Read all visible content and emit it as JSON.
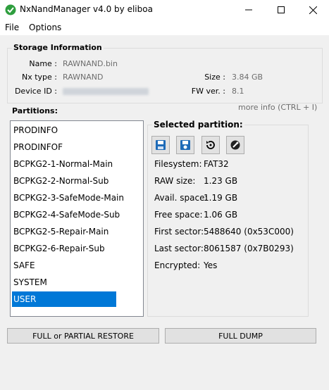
{
  "window": {
    "title": "NxNandManager v4.0 by eliboa",
    "controls": [
      "minimize-icon",
      "maximize-icon",
      "close-icon"
    ],
    "icon": "app-leaf-icon"
  },
  "menu": {
    "file": "File",
    "options": "Options"
  },
  "storage": {
    "title": "Storage Information",
    "name_label": "Name :",
    "name_value": "RAWNAND.bin",
    "nxtype_label": "Nx type :",
    "nxtype_value": "RAWNAND",
    "deviceid_label": "Device ID :",
    "size_label": "Size :",
    "size_value": "3.84 GB",
    "fw_label": "FW ver. :",
    "fw_value": "8.1",
    "more_info": "more info (CTRL + I)"
  },
  "partitions": {
    "title": "Partitions:",
    "items": [
      {
        "label": "PRODINFO"
      },
      {
        "label": "PRODINFOF"
      },
      {
        "label": "BCPKG2-1-Normal-Main"
      },
      {
        "label": "BCPKG2-2-Normal-Sub"
      },
      {
        "label": "BCPKG2-3-SafeMode-Main"
      },
      {
        "label": "BCPKG2-4-SafeMode-Sub"
      },
      {
        "label": "BCPKG2-5-Repair-Main"
      },
      {
        "label": "BCPKG2-6-Repair-Sub"
      },
      {
        "label": "SAFE"
      },
      {
        "label": "SYSTEM"
      },
      {
        "label": "USER"
      }
    ],
    "selected": "USER"
  },
  "selected_partition": {
    "title": "Selected partition:",
    "tools": [
      "dump-icon",
      "dump-to-folder-icon",
      "restore-icon",
      "crypto-icon"
    ],
    "filesystem_label": "Filesystem:",
    "filesystem_value": "FAT32",
    "rawsize_label": "RAW size:",
    "rawsize_value": "1.23 GB",
    "avail_label": "Avail. space:",
    "avail_value": "1.19 GB",
    "free_label": "Free space:",
    "free_value": "1.06 GB",
    "first_label": "First sector:",
    "first_value": "5488640 (0x53C000)",
    "last_label": "Last sector:",
    "last_value": "8061587 (0x7B0293)",
    "encrypted_label": "Encrypted:",
    "encrypted_value": "Yes"
  },
  "buttons": {
    "restore": "FULL or PARTIAL RESTORE",
    "dump": "FULL DUMP"
  },
  "colors": {
    "selection": "#0078d7",
    "accent_icon": "#1e6bb8"
  }
}
